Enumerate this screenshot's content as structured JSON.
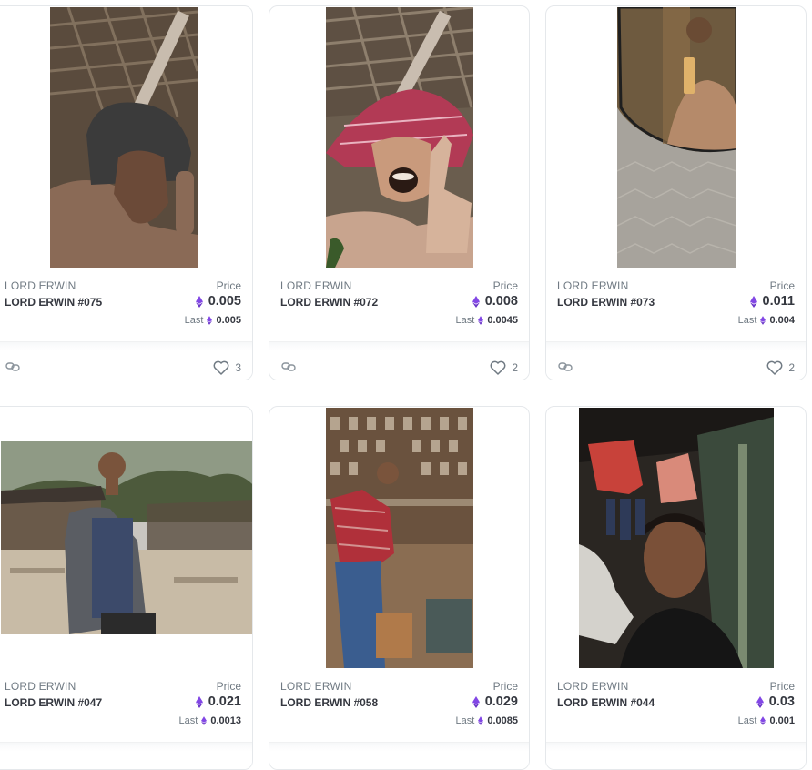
{
  "cards": [
    {
      "collection": "LORD ERWIN",
      "name": "LORD ERWIN #075",
      "price_label": "Price",
      "price": "0.005",
      "last_label": "Last",
      "last": "0.005",
      "likes": "3"
    },
    {
      "collection": "LORD ERWIN",
      "name": "LORD ERWIN #072",
      "price_label": "Price",
      "price": "0.008",
      "last_label": "Last",
      "last": "0.0045",
      "likes": "2"
    },
    {
      "collection": "LORD ERWIN",
      "name": "LORD ERWIN #073",
      "price_label": "Price",
      "price": "0.011",
      "last_label": "Last",
      "last": "0.004",
      "likes": "2"
    },
    {
      "collection": "LORD ERWIN",
      "name": "LORD ERWIN #047",
      "price_label": "Price",
      "price": "0.021",
      "last_label": "Last",
      "last": "0.0013"
    },
    {
      "collection": "LORD ERWIN",
      "name": "LORD ERWIN #058",
      "price_label": "Price",
      "price": "0.029",
      "last_label": "Last",
      "last": "0.0085"
    },
    {
      "collection": "LORD ERWIN",
      "name": "LORD ERWIN #044",
      "price_label": "Price",
      "price": "0.03",
      "last_label": "Last",
      "last": "0.001"
    }
  ],
  "colors": {
    "eth": "#8247e5",
    "text": "#353840",
    "muted": "#707a83",
    "border": "#e5e8eb"
  },
  "icons": {
    "currency": "ethereum-icon",
    "link": "link-chain-icon",
    "like": "heart-icon"
  }
}
